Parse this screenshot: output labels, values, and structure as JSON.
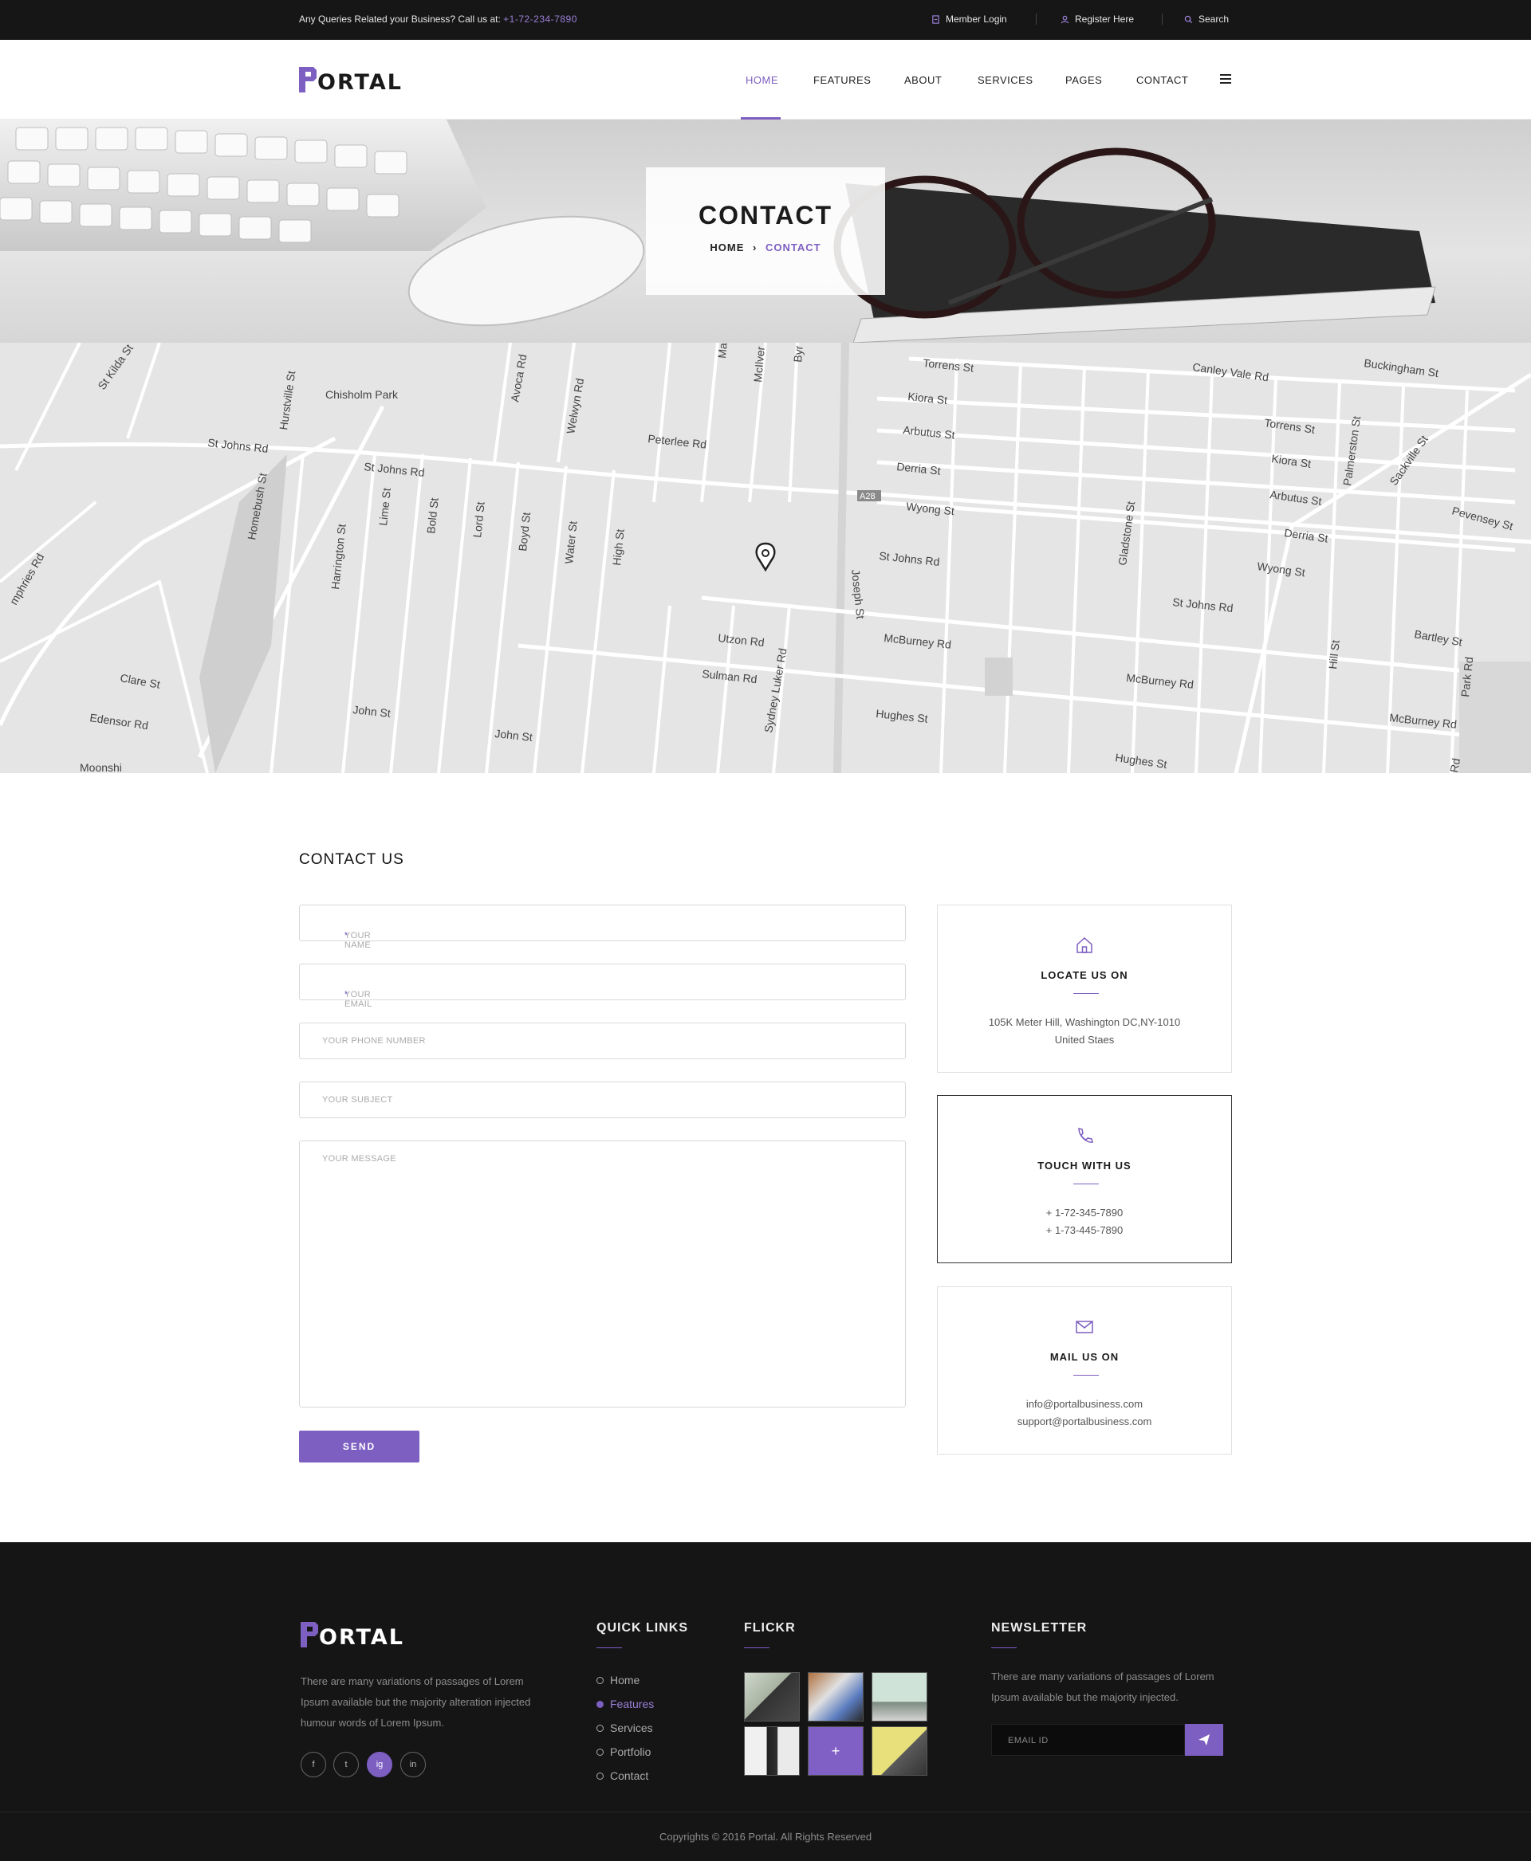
{
  "topbar": {
    "query_text": "Any Queries Related your Business? Call us at:",
    "phone": "+1-72-234-7890",
    "member_login": "Member Login",
    "register": "Register Here",
    "search": "Search"
  },
  "header": {
    "logo_text": "ORTAL",
    "nav": [
      "HOME",
      "FEATURES",
      "ABOUT",
      "SERVICES",
      "PAGES",
      "CONTACT"
    ],
    "active": "HOME"
  },
  "banner": {
    "title": "CONTACT",
    "crumb_home": "HOME",
    "crumb_sep": "›",
    "crumb_current": "CONTACT"
  },
  "map": {
    "labels": [
      "St Kilda St",
      "Chisholm Park",
      "Hurstville St",
      "Avoca Rd",
      "Welwyn Rd",
      "Mai",
      "McIlver",
      "Byr",
      "Torrens St",
      "Canley Vale Rd",
      "Buckingham St",
      "Kiora St",
      "Arbutus St",
      "Derria St",
      "Wyong St",
      "A28",
      "Peterlee Rd",
      "St Johns Rd",
      "St Johns Rd",
      "Homebush St",
      "Harrington St",
      "Lime St",
      "Bold St",
      "Lord St",
      "Boyd St",
      "Water St",
      "High St",
      "Joseph St",
      "St Johns Rd",
      "Gladstone St",
      "Torrens St",
      "Kiora St",
      "Arbutus St",
      "Derria St",
      "Wyong St",
      "St Johns Rd",
      "Palmerston St",
      "Sackville St",
      "Pevensey St",
      "Bartley St",
      "Utzon Rd",
      "Sulman Rd",
      "Sydney Luker Rd",
      "McBurney Rd",
      "McBurney Rd",
      "McBurney Rd",
      "Hill St",
      "Park Rd",
      "Clare St",
      "Edensor Rd",
      "John St",
      "John St",
      "Hughes St",
      "Hughes St",
      "Moonshi",
      "mphries Rd",
      "Rd"
    ]
  },
  "contact": {
    "title": "CONTACT US",
    "name_placeholder": "YOUR NAME",
    "email_placeholder": "YOUR EMAIL",
    "phone_placeholder": "YOUR PHONE NUMBER",
    "subject_placeholder": "YOUR SUBJECT",
    "message_placeholder": "YOUR MESSAGE",
    "required_mark": "*",
    "send_label": "SEND"
  },
  "info": {
    "locate": {
      "title": "LOCATE US ON",
      "line1": "105K Meter Hill, Washington DC,NY-1010",
      "line2": "United Staes"
    },
    "touch": {
      "title": "TOUCH WITH US",
      "line1": "+ 1-72-345-7890",
      "line2": "+ 1-73-445-7890"
    },
    "mail": {
      "title": "MAIL US ON",
      "line1": "info@portalbusiness.com",
      "line2": "support@portalbusiness.com"
    }
  },
  "footer": {
    "logo_text": "ORTAL",
    "description": "There are many variations of passages of Lorem Ipsum available but the majority alteration injected humour words of Lorem Ipsum.",
    "social": [
      "f",
      "t",
      "ig",
      "in"
    ],
    "quick_links_title": "QUICK LINKS",
    "quick_links": [
      "Home",
      "Features",
      "Services",
      "Portfolio",
      "Contact"
    ],
    "active_link": "Features",
    "flickr_title": "FLICKR",
    "newsletter_title": "NEWSLETTER",
    "newsletter_desc": "There are many variations of passages of Lorem Ipsum available but the majority injected.",
    "email_placeholder": "EMAIL ID",
    "copyright": "Copyrights © 2016 Portal. All Rights Reserved"
  },
  "colors": {
    "accent": "#7d5ec1",
    "dark": "#151515",
    "topbar": "#161616"
  }
}
